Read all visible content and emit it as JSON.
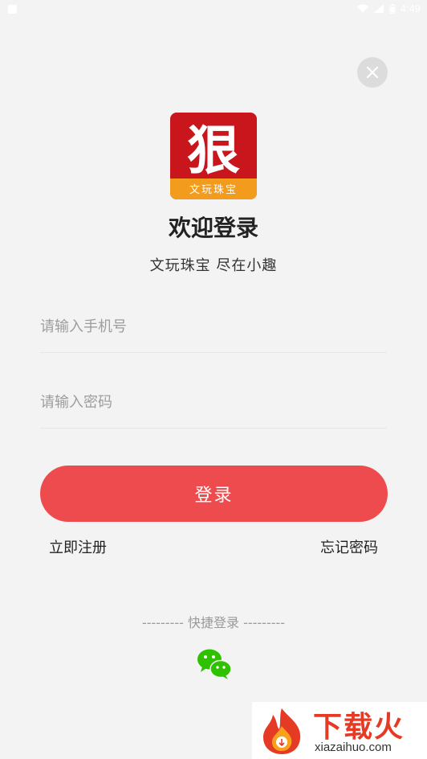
{
  "status_bar": {
    "time": "4:49"
  },
  "logo": {
    "glyph": "狠",
    "band_text": "文玩珠宝",
    "colors": {
      "background": "#c9161c",
      "band": "#f29b1d"
    }
  },
  "welcome": {
    "title": "欢迎登录",
    "subtitle": "文玩珠宝 尽在小趣"
  },
  "form": {
    "phone_placeholder": "请输入手机号",
    "password_placeholder": "请输入密码",
    "login_label": "登录"
  },
  "links": {
    "register": "立即注册",
    "forgot": "忘记密码"
  },
  "quick_login": {
    "label": "--------- 快捷登录 ---------",
    "provider_icon": "wechat-icon"
  },
  "watermark": {
    "main": "下载火",
    "sub": "xiazaihuo.com"
  },
  "colors": {
    "accent": "#ee4b4f",
    "background": "#f3f3f3",
    "wechat": "#2dc100"
  }
}
